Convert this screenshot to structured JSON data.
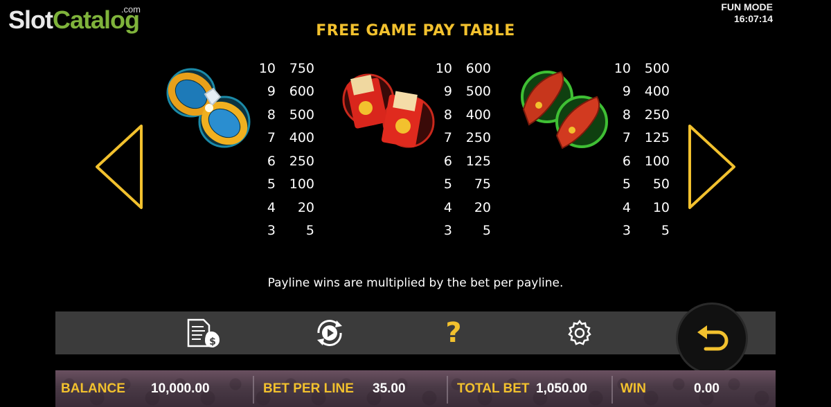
{
  "logo": {
    "slot": "Slot",
    "catalog": "Catalog",
    "com": ".com"
  },
  "mode": {
    "label": "FUN MODE",
    "time": "16:07:14"
  },
  "title": "FREE GAME PAY TABLE",
  "paytables": [
    {
      "symbol": "wedding-rings",
      "rows": [
        [
          "10",
          "750"
        ],
        [
          "9",
          "600"
        ],
        [
          "8",
          "500"
        ],
        [
          "7",
          "400"
        ],
        [
          "6",
          "250"
        ],
        [
          "5",
          "100"
        ],
        [
          "4",
          "20"
        ],
        [
          "3",
          "5"
        ]
      ]
    },
    {
      "symbol": "red-envelopes",
      "rows": [
        [
          "10",
          "600"
        ],
        [
          "9",
          "500"
        ],
        [
          "8",
          "400"
        ],
        [
          "7",
          "250"
        ],
        [
          "6",
          "125"
        ],
        [
          "5",
          "75"
        ],
        [
          "4",
          "20"
        ],
        [
          "3",
          "5"
        ]
      ]
    },
    {
      "symbol": "red-shoes",
      "rows": [
        [
          "10",
          "500"
        ],
        [
          "9",
          "400"
        ],
        [
          "8",
          "250"
        ],
        [
          "7",
          "125"
        ],
        [
          "6",
          "100"
        ],
        [
          "5",
          "50"
        ],
        [
          "4",
          "10"
        ],
        [
          "3",
          "5"
        ]
      ]
    }
  ],
  "note": "Payline wins are multiplied by the bet per payline.",
  "toolbar": {
    "icons": [
      "paytable-money-icon",
      "autoplay-icon",
      "help-icon",
      "settings-gear-icon",
      "back-arrow-icon"
    ],
    "help_glyph": "?"
  },
  "status": {
    "balance_label": "BALANCE",
    "balance_value": "10,000.00",
    "bet_label": "BET PER LINE",
    "bet_value": "35.00",
    "total_label": "TOTAL BET",
    "total_value": "1,050.00",
    "win_label": "WIN",
    "win_value": "0.00"
  },
  "colors": {
    "accent": "#f2c12e",
    "brand_green": "#7fb33b",
    "toolbar": "#3b3b3b"
  }
}
